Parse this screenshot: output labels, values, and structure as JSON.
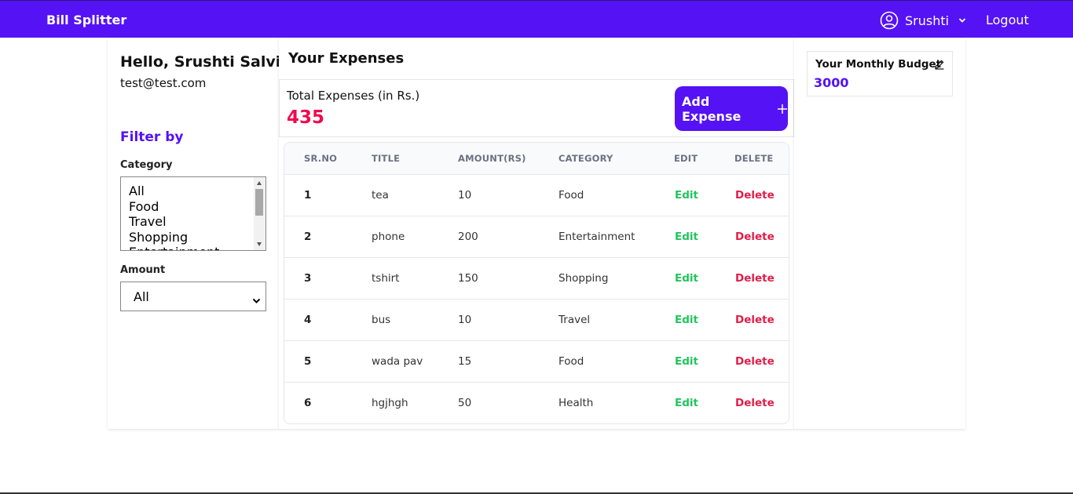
{
  "navbar": {
    "brand": "Bill Splitter",
    "user_name": "Srushti",
    "logout_label": "Logout"
  },
  "sidebar": {
    "greeting": "Hello, Srushti Salvi",
    "email": "test@test.com",
    "filter_title": "Filter by",
    "category_label": "Category",
    "category_options": [
      "All",
      "Food",
      "Travel",
      "Shopping",
      "Entertainment"
    ],
    "amount_label": "Amount",
    "amount_selected": "All"
  },
  "expenses": {
    "title": "Your Expenses",
    "total_label": "Total Expenses (in Rs.)",
    "total_value": "435",
    "add_button_label": "Add Expense",
    "columns": [
      "SR.NO",
      "TITLE",
      "AMOUNT(RS)",
      "CATEGORY",
      "EDIT",
      "DELETE"
    ],
    "rows": [
      {
        "sr": "1",
        "title": "tea",
        "amount": "10",
        "category": "Food",
        "edit": "Edit",
        "delete": "Delete"
      },
      {
        "sr": "2",
        "title": "phone",
        "amount": "200",
        "category": "Entertainment",
        "edit": "Edit",
        "delete": "Delete"
      },
      {
        "sr": "3",
        "title": "tshirt",
        "amount": "150",
        "category": "Shopping",
        "edit": "Edit",
        "delete": "Delete"
      },
      {
        "sr": "4",
        "title": "bus",
        "amount": "10",
        "category": "Travel",
        "edit": "Edit",
        "delete": "Delete"
      },
      {
        "sr": "5",
        "title": "wada pav",
        "amount": "15",
        "category": "Food",
        "edit": "Edit",
        "delete": "Delete"
      },
      {
        "sr": "6",
        "title": "hgjhgh",
        "amount": "50",
        "category": "Health",
        "edit": "Edit",
        "delete": "Delete"
      }
    ]
  },
  "budget": {
    "label": "Your Monthly Budget",
    "value": "3000"
  },
  "colors": {
    "primary": "#5512f5",
    "total": "#ee0a4f",
    "edit": "#21c55d",
    "delete": "#e11d48"
  },
  "icons": {
    "user": "user-circle-icon",
    "chevron": "chevron-down-icon",
    "plus": "plus-icon",
    "pencil": "pencil-icon"
  }
}
